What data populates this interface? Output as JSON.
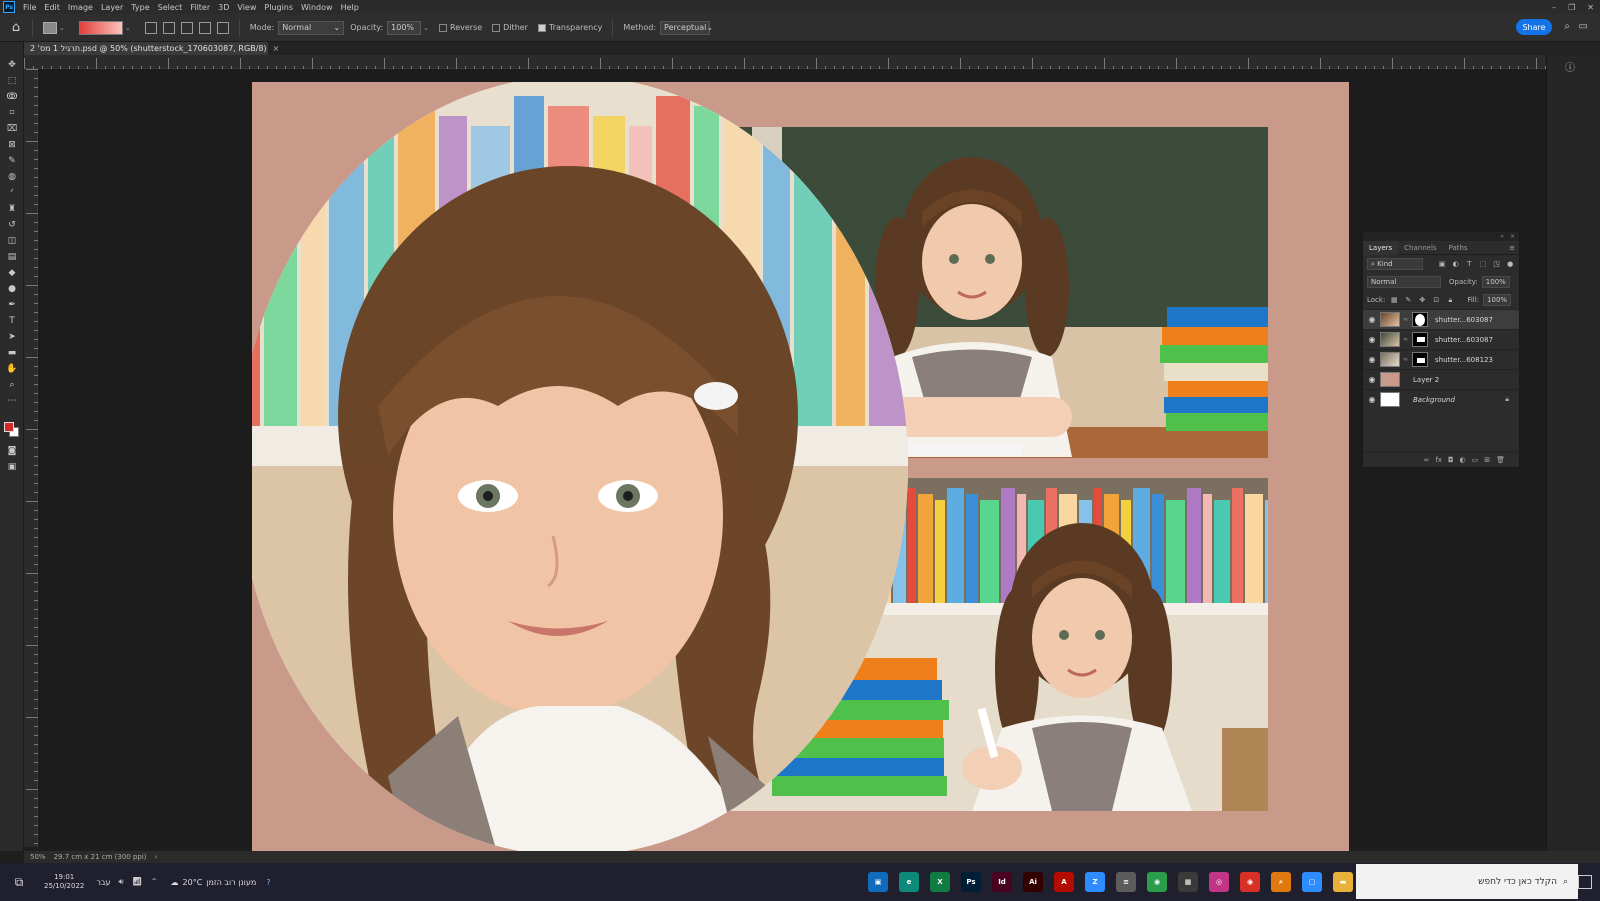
{
  "app": {
    "name": "Ps"
  },
  "menu": [
    "File",
    "Edit",
    "Image",
    "Layer",
    "Type",
    "Select",
    "Filter",
    "3D",
    "View",
    "Plugins",
    "Window",
    "Help"
  ],
  "window_controls": [
    "–",
    "❐",
    "✕"
  ],
  "options": {
    "mode_label": "Mode:",
    "mode_value": "Normal",
    "opacity_label": "Opacity:",
    "opacity_value": "100%",
    "reverse_label": "Reverse",
    "dither_label": "Dither",
    "transparency_label": "Transparency",
    "method_label": "Method:",
    "method_value": "Perceptual",
    "share_label": "Share"
  },
  "document": {
    "tab_title": "תרגיל 1 מס' 2.psd @ 50% (shutterstock_170603087, RGB/8)",
    "close": "×"
  },
  "canvas": {
    "background_color": "#c99a89"
  },
  "layers_panel": {
    "tabs": [
      "Layers",
      "Channels",
      "Paths"
    ],
    "filter_value": "Kind",
    "blend_mode": "Normal",
    "opacity_label": "Opacity:",
    "opacity_value": "100%",
    "lock_label": "Lock:",
    "fill_label": "Fill:",
    "fill_value": "100%",
    "layers": [
      {
        "name": "shutter...603087",
        "selected": true,
        "has_mask": true
      },
      {
        "name": "shutter...603087",
        "selected": false,
        "has_mask": true
      },
      {
        "name": "shutter...608123",
        "selected": false,
        "has_mask": true
      },
      {
        "name": "Layer 2",
        "selected": false,
        "has_mask": false,
        "color": "#c99a89"
      },
      {
        "name": "Background",
        "selected": false,
        "has_mask": false,
        "locked": true,
        "color": "#ffffff"
      }
    ]
  },
  "status": {
    "zoom": "50%",
    "doc_size": "29.7 cm x 21 cm (300 ppi)"
  },
  "taskbar": {
    "time": "19:01",
    "date": "25/10/2022",
    "lang": "עבר",
    "weather_temp": "20°C",
    "weather_text": "מעונן רוב הזמן",
    "search_placeholder": "הקלד כאן כדי לחפש",
    "apps": [
      {
        "name": "Photos",
        "label": "▣",
        "color": "#0f6cbd"
      },
      {
        "name": "Edge",
        "label": "e",
        "color": "#0d8a7a"
      },
      {
        "name": "Excel",
        "label": "X",
        "color": "#107c41"
      },
      {
        "name": "Photoshop",
        "label": "Ps",
        "color": "#001e36"
      },
      {
        "name": "InDesign",
        "label": "Id",
        "color": "#49021f"
      },
      {
        "name": "Illustrator",
        "label": "Ai",
        "color": "#330000"
      },
      {
        "name": "Acrobat",
        "label": "A",
        "color": "#b30b00"
      },
      {
        "name": "Zoom",
        "label": "Z",
        "color": "#2d8cff"
      },
      {
        "name": "Notepad",
        "label": "≡",
        "color": "#5c5c5c"
      },
      {
        "name": "Chrome",
        "label": "◉",
        "color": "#2a9d4a"
      },
      {
        "name": "Calculator",
        "label": "▦",
        "color": "#3a3a3a"
      },
      {
        "name": "Instagram",
        "label": "◎",
        "color": "#c13584"
      },
      {
        "name": "Chrome2",
        "label": "◉",
        "color": "#d93025"
      },
      {
        "name": "Search",
        "label": "⌕",
        "color": "#e07a10"
      },
      {
        "name": "Teams",
        "label": "▢",
        "color": "#2d8cff"
      },
      {
        "name": "Explorer",
        "label": "▬",
        "color": "#e8b23a"
      }
    ]
  }
}
